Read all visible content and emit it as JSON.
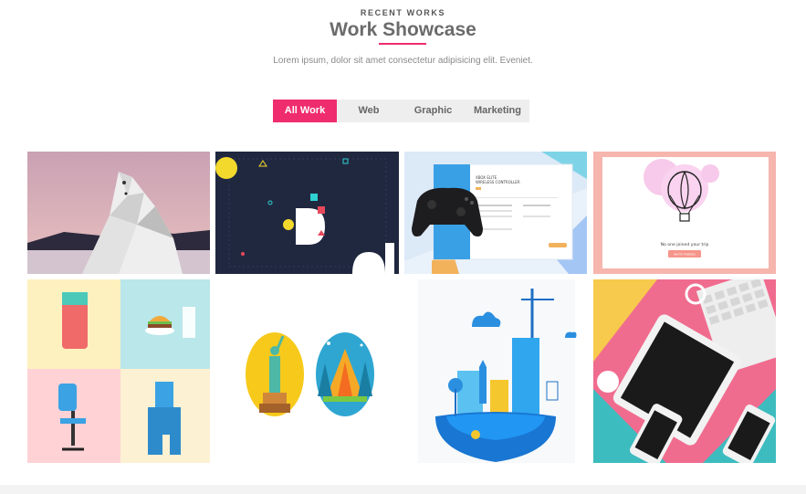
{
  "section": {
    "eyebrow": "RECENT WORKS",
    "title": "Work Showcase",
    "subtitle": "Lorem ipsum, dolor sit amet consectetur adipisicing elit. Eveniet."
  },
  "filters": {
    "items": [
      "All Work",
      "Web",
      "Graphic",
      "Marketing"
    ],
    "active": "All Work"
  },
  "portfolio": {
    "items": [
      {
        "name": "polar-bear-illustration"
      },
      {
        "name": "letter-d-poster",
        "letter": "D"
      },
      {
        "name": "controller-product-page",
        "heading": "XBOX ELITE\nWIRELESS CONTROLLER"
      },
      {
        "name": "hot-air-balloon-card",
        "caption": "No one joined your trip",
        "button": "INVITE FRIENDS"
      },
      {
        "name": "flat-objects-grid"
      },
      {
        "name": "landmark-icons"
      },
      {
        "name": "city-island-illustration"
      },
      {
        "name": "devices-flatlay"
      }
    ]
  },
  "colors": {
    "accent": "#ef2d6e",
    "filter_bg": "#eeeeee",
    "heading": "#6b6b6b"
  }
}
